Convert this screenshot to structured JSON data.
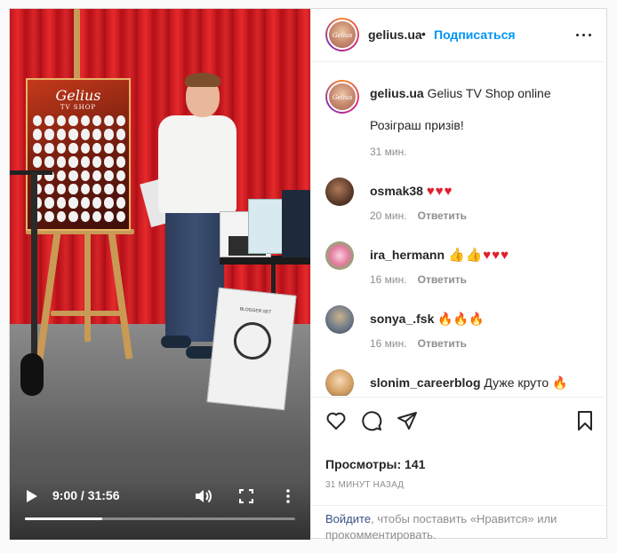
{
  "post": {
    "username": "gelius.ua",
    "follow_label": "Подписаться",
    "dot": "•",
    "avatar_text": "Gelius"
  },
  "caption": {
    "username": "gelius.ua",
    "text": "Gelius TV Shop online",
    "line2": "Розіграш призів!",
    "time": "31 мин."
  },
  "comments": [
    {
      "username": "osmak38",
      "text": "♥♥♥",
      "emoji_kind": "hearts",
      "time": "20 мин.",
      "reply": "Ответить"
    },
    {
      "username": "ira_hermann",
      "text": "👍👍♥♥♥",
      "emoji_kind": "thumbs-hearts",
      "time": "16 мин.",
      "reply": "Ответить"
    },
    {
      "username": "sonya_.fsk",
      "text": "🔥🔥🔥",
      "emoji_kind": "fire",
      "time": "16 мин.",
      "reply": "Ответить"
    },
    {
      "username": "slonim_careerblog",
      "text": "Дуже круто 🔥",
      "emoji_kind": "text-fire",
      "time": "",
      "reply": ""
    }
  ],
  "video": {
    "time_display": "9:00 / 31:56",
    "progress": 0.287,
    "board_title": "Gelius",
    "board_sub": "TV SHOP",
    "box_label": "BLOGGER SET"
  },
  "stats": {
    "views": "Просмотры: 141",
    "ago": "31 МИНУТ НАЗАД"
  },
  "login": {
    "link": "Войдите",
    "text": ", чтобы поставить «Нравится» или прокомментировать."
  },
  "colors": {
    "accent": "#0095f6",
    "heart": "#e0202e",
    "text": "#262626",
    "muted": "#8e8e8e"
  }
}
